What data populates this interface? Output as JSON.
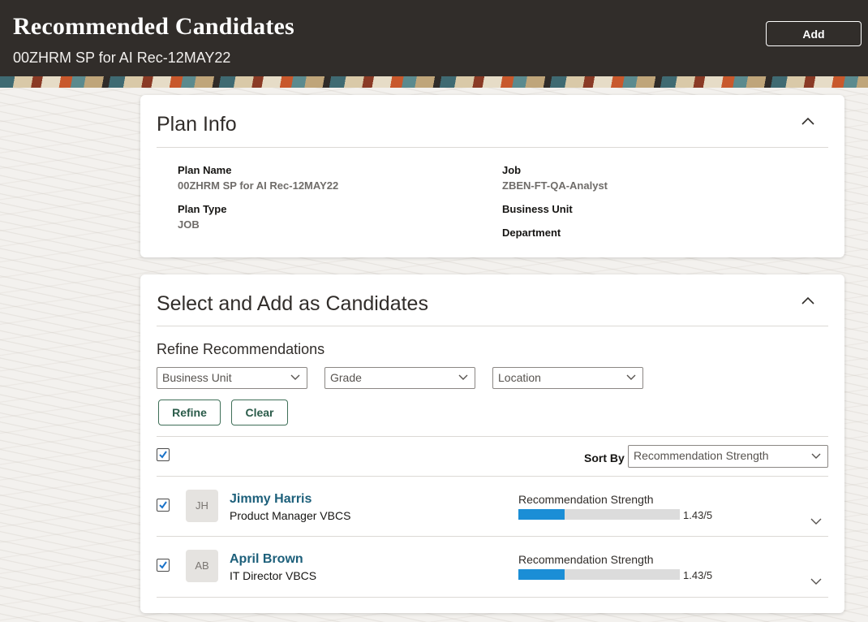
{
  "header": {
    "title": "Recommended Candidates",
    "subtitle": "00ZHRM SP for AI Rec-12MAY22",
    "add_label": "Add"
  },
  "plan_info": {
    "title": "Plan Info",
    "plan_name_label": "Plan Name",
    "plan_name_value": "00ZHRM SP for AI Rec-12MAY22",
    "plan_type_label": "Plan Type",
    "plan_type_value": "JOB",
    "job_label": "Job",
    "job_value": "ZBEN-FT-QA-Analyst",
    "business_unit_label": "Business Unit",
    "department_label": "Department"
  },
  "select_section": {
    "title": "Select and Add as Candidates",
    "refine_title": "Refine Recommendations",
    "filters": [
      "Business Unit",
      "Grade",
      "Location"
    ],
    "refine_label": "Refine",
    "clear_label": "Clear",
    "sort_by_label": "Sort By",
    "sort_by_value": "Recommendation Strength",
    "select_all_checked": true
  },
  "candidates": [
    {
      "initials": "JH",
      "name": "Jimmy Harris",
      "title": "Product Manager VBCS",
      "strength_label": "Recommendation Strength",
      "strength_text": "1.43/5",
      "strength_fraction": 0.286,
      "checked": true
    },
    {
      "initials": "AB",
      "name": "April Brown",
      "title": "IT Director VBCS",
      "strength_label": "Recommendation Strength",
      "strength_text": "1.43/5",
      "strength_fraction": 0.286,
      "checked": true
    }
  ],
  "colors": {
    "header_bg": "#312d2a",
    "link": "#1c5f7a",
    "bar_fill": "#1b8ed6",
    "button_border": "#3f6f58"
  }
}
